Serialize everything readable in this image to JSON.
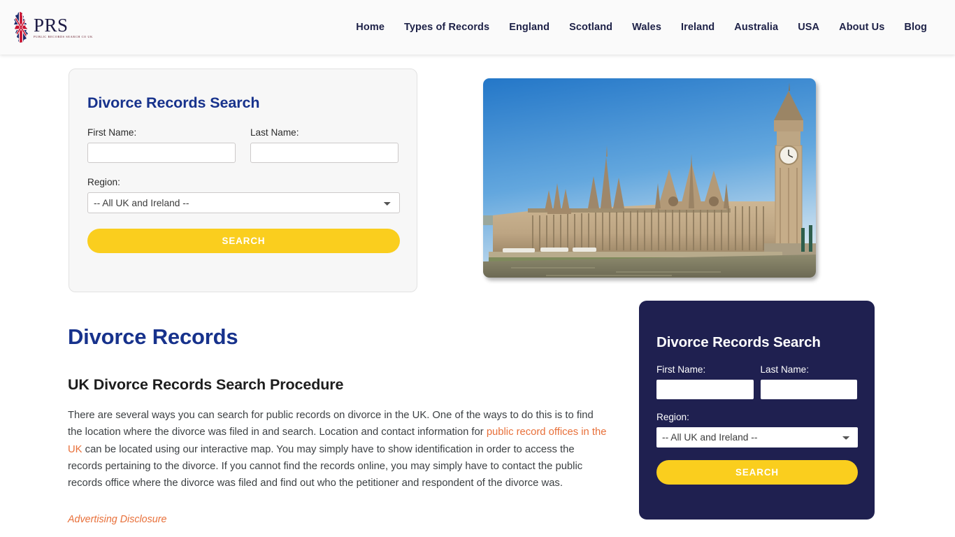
{
  "header": {
    "logo": {
      "brand": "PRS",
      "tagline": "PUBLIC RECORDS SEARCH CO UK",
      "icon": "uk-map-union-jack-icon"
    },
    "nav": [
      {
        "label": "Home"
      },
      {
        "label": "Types of Records"
      },
      {
        "label": "England"
      },
      {
        "label": "Scotland"
      },
      {
        "label": "Wales"
      },
      {
        "label": "Ireland"
      },
      {
        "label": "Australia"
      },
      {
        "label": "USA"
      },
      {
        "label": "About Us"
      },
      {
        "label": "Blog"
      }
    ]
  },
  "hero_search": {
    "title": "Divorce Records Search",
    "first_name_label": "First Name:",
    "first_name_value": "",
    "last_name_label": "Last Name:",
    "last_name_value": "",
    "region_label": "Region:",
    "region_selected": "-- All UK and Ireland --",
    "region_options": [
      "-- All UK and Ireland --"
    ],
    "search_button": "SEARCH"
  },
  "hero_image": {
    "alt": "Palace of Westminster and Big Ben beside the River Thames",
    "sky_color": "#2f86d0",
    "stone_color": "#c0a784",
    "water_color": "#7d7b63"
  },
  "content": {
    "page_title": "Divorce Records",
    "sub_heading": "UK Divorce Records Search Procedure",
    "paragraph_part1": "There are several ways you can search for public records on divorce in the UK. One of the ways to do this is to find the location where the divorce was filed in and search. Location and contact information for ",
    "paragraph_link": "public record offices in the UK",
    "paragraph_part2": " can be located using our interactive map. You may simply have to show identification in order to access the records pertaining to the divorce. If you cannot find the records online, you may simply have to contact the public records office where the divorce was filed and find out who the petitioner and respondent of the divorce was.",
    "advertising_disclosure": "Advertising Disclosure"
  },
  "sidebar_search": {
    "title": "Divorce Records Search",
    "first_name_label": "First Name:",
    "first_name_value": "",
    "last_name_label": "Last Name:",
    "last_name_value": "",
    "region_label": "Region:",
    "region_selected": "-- All UK and Ireland --",
    "region_options": [
      "-- All UK and Ireland --"
    ],
    "search_button": "SEARCH"
  },
  "colors": {
    "brand_navy": "#17328c",
    "dark_card": "#1f2050",
    "accent_yellow": "#face1e",
    "link_orange": "#e8703a",
    "header_bg": "#fafafa"
  }
}
